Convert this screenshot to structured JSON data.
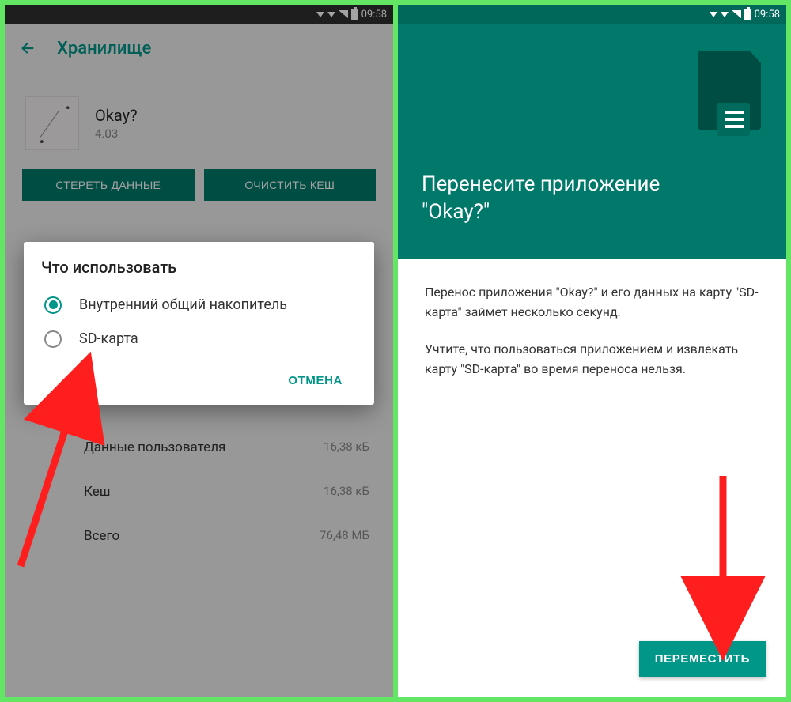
{
  "status": {
    "time": "09:58"
  },
  "left": {
    "title": "Хранилище",
    "app": {
      "name": "Okay?",
      "version": "4.03"
    },
    "buttons": {
      "clear_data": "СТЕРЕТЬ ДАННЫЕ",
      "clear_cache": "ОЧИСТИТЬ КЕШ"
    },
    "rows": [
      {
        "label": "Данные пользователя",
        "value": "16,38 кБ"
      },
      {
        "label": "Кеш",
        "value": "16,38 кБ"
      },
      {
        "label": "Всего",
        "value": "76,48 МБ"
      }
    ],
    "dialog": {
      "title": "Что использовать",
      "options": [
        {
          "label": "Внутренний общий накопитель",
          "checked": true
        },
        {
          "label": "SD-карта",
          "checked": false
        }
      ],
      "cancel": "ОТМЕНА"
    }
  },
  "right": {
    "title": "Перенесите приложение \"Okay?\"",
    "p1": "Перенос приложения \"Okay?\" и его данных на карту \"SD-карта\" займет несколько секунд.",
    "p2": "Учтите, что пользоваться приложением и извлекать карту \"SD-карта\" во время переноса нельзя.",
    "move": "ПЕРЕМЕСТИТЬ"
  },
  "colors": {
    "accent": "#009688",
    "teal_dark": "#00796b",
    "arrow": "#ff1e1e"
  }
}
